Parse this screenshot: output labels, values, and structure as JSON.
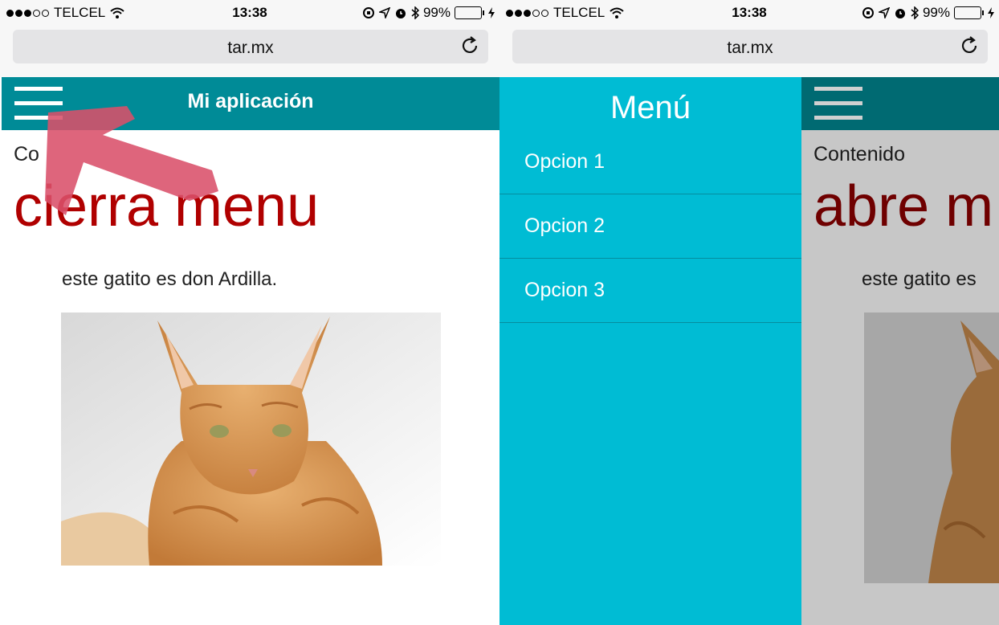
{
  "status_bar": {
    "carrier": "TELCEL",
    "time": "13:38",
    "battery_percent": "99%",
    "battery_level": 0.99,
    "icons": [
      "signal-dots-icon",
      "wifi-icon",
      "orientation-lock-icon",
      "location-icon",
      "alarm-icon",
      "bluetooth-icon",
      "battery-icon",
      "charging-icon"
    ]
  },
  "browser": {
    "url": "tar.mx",
    "reload_icon": "reload-icon"
  },
  "app": {
    "title": "Mi aplicación",
    "menu_icon": "hamburger-menu-icon"
  },
  "left_screen": {
    "content_label": "Co",
    "big_title": "cierra menu",
    "caption": "este gatito es don Ardilla.",
    "annotation": "red-arrow-annotation"
  },
  "right_screen": {
    "drawer_title": "Menú",
    "menu_items": [
      {
        "label": "Opcion 1"
      },
      {
        "label": "Opcion 2"
      },
      {
        "label": "Opcion 3"
      }
    ],
    "content_label": "Contenido",
    "big_title": "abre m",
    "caption": "este gatito es"
  },
  "colors": {
    "app_bar": "#008b97",
    "app_bar_dimmed": "#006a72",
    "drawer": "#00bcd4",
    "title_red": "#b00000",
    "annotation": "#d9506a"
  }
}
